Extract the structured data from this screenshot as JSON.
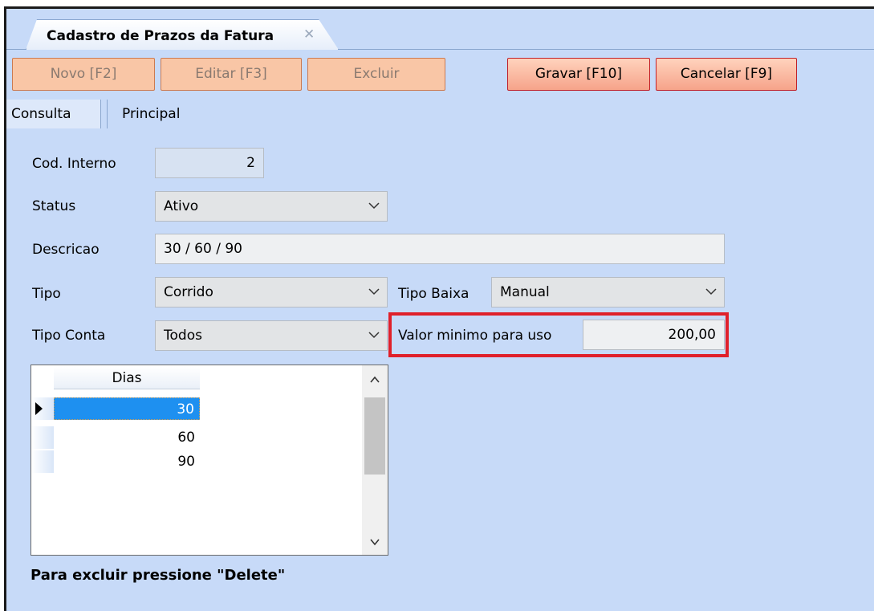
{
  "window": {
    "tab_title": "Cadastro de Prazos da Fatura",
    "tab_close": "✕"
  },
  "toolbar": {
    "novo": "Novo [F2]",
    "editar": "Editar [F3]",
    "excluir": "Excluir",
    "gravar": "Gravar [F10]",
    "cancelar": "Cancelar [F9]"
  },
  "subtabs": {
    "consulta": "Consulta",
    "principal": "Principal"
  },
  "form": {
    "cod_interno_label": "Cod. Interno",
    "cod_interno_value": "2",
    "status_label": "Status",
    "status_value": "Ativo",
    "descricao_label": "Descricao",
    "descricao_value": "30 / 60 / 90",
    "tipo_label": "Tipo",
    "tipo_value": "Corrido",
    "tipo_baixa_label": "Tipo Baixa",
    "tipo_baixa_value": "Manual",
    "tipo_conta_label": "Tipo Conta",
    "tipo_conta_value": "Todos",
    "valor_minimo_label": "Valor minimo para uso",
    "valor_minimo_value": "200,00"
  },
  "grid": {
    "header": "Dias",
    "rows": [
      "30",
      "60",
      "90"
    ],
    "selected_index": 0
  },
  "footer": {
    "hint": "Para excluir pressione \"Delete\""
  },
  "colors": {
    "background": "#c7daf8",
    "highlight": "#e0202a",
    "selection": "#1e90f0"
  }
}
